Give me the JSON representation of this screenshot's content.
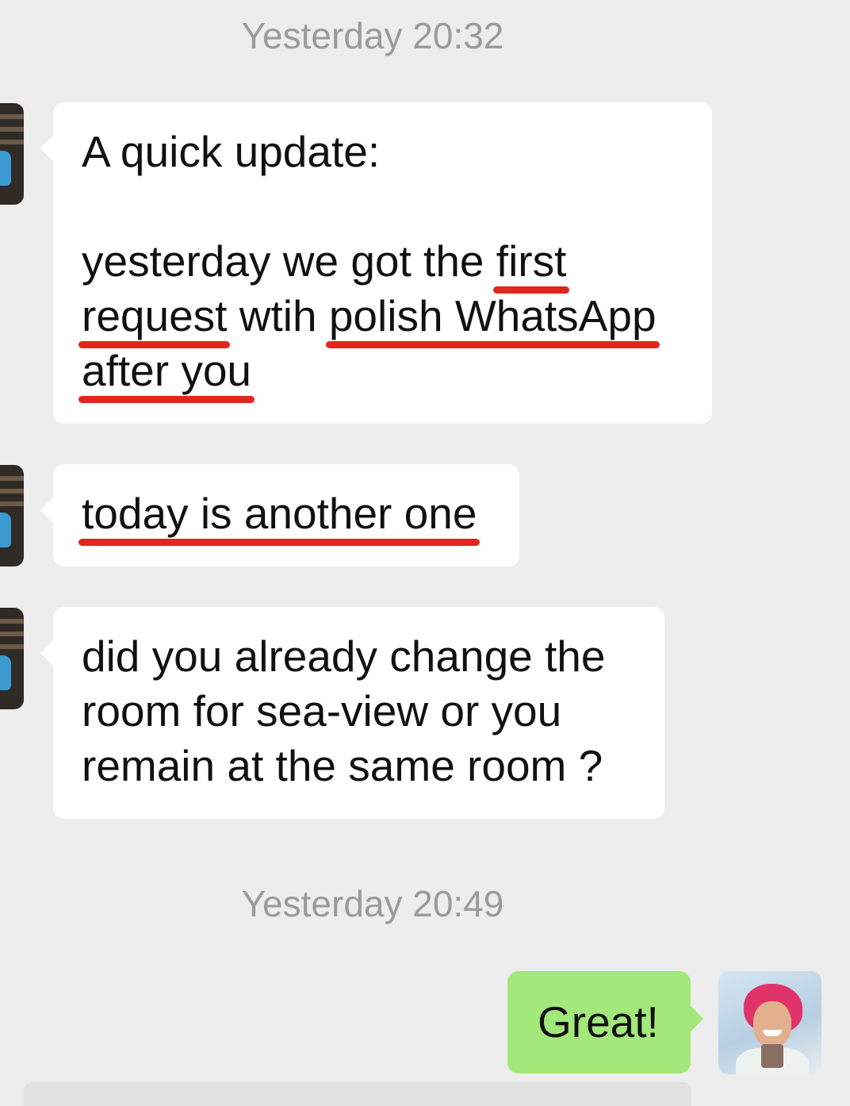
{
  "chat": {
    "timestamp_1": "Yesterday 20:32",
    "timestamp_2": "Yesterday 20:49",
    "msg1": {
      "l1": "A quick update:",
      "l3_a": "yesterday we got the ",
      "l3_b": "first",
      "l4_a": "request",
      "l4_b": " wtih ",
      "l4_c": "polish WhatsApp",
      "l5_a": "after you"
    },
    "msg2": {
      "text": "today is another one"
    },
    "msg3": {
      "l1": "did you already change the",
      "l2": "room for sea-view or you",
      "l3": "remain at the same room ?"
    },
    "msg4": {
      "text": "Great!"
    }
  },
  "colors": {
    "background": "#ededed",
    "incoming_bubble": "#ffffff",
    "outgoing_bubble": "#a3e87a",
    "underline_annotation": "#e2261e",
    "timestamp_text": "#9b9b9b"
  },
  "icons": {
    "contact_avatar": "contact-avatar-icon",
    "my_avatar": "my-avatar-icon"
  }
}
